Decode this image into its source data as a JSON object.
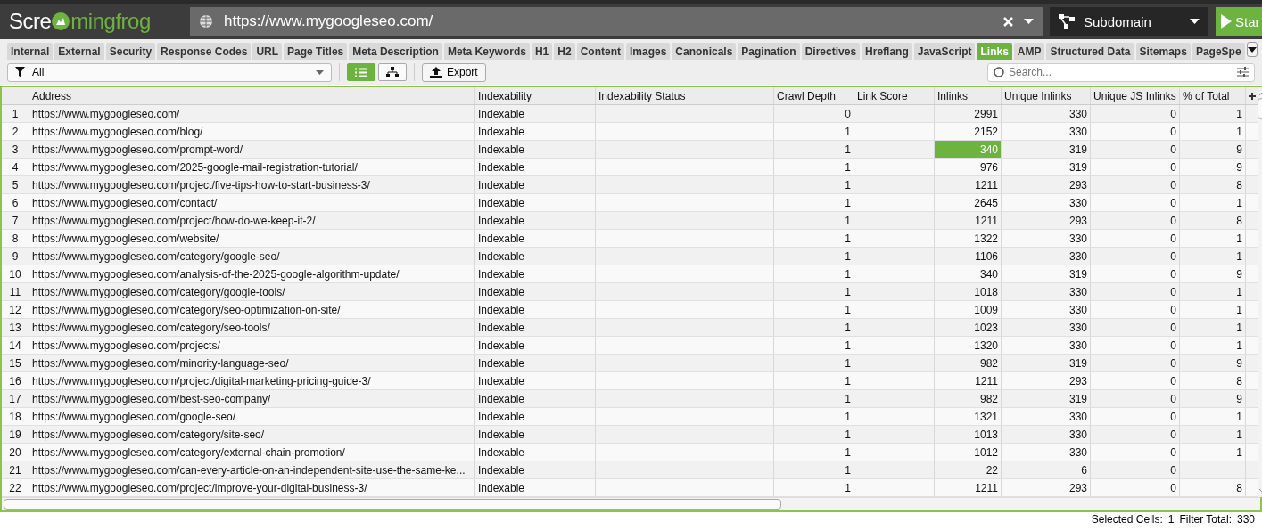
{
  "header": {
    "logo": {
      "before": "Scre",
      "after": "mingfrog"
    },
    "url_field": {
      "value": "https://www.mygoogleseo.com/"
    },
    "mode_dropdown": {
      "label": "Subdomain"
    },
    "start_button": {
      "label": "Star"
    }
  },
  "tabs": [
    {
      "label": "Internal",
      "selected": false
    },
    {
      "label": "External",
      "selected": false
    },
    {
      "label": "Security",
      "selected": false
    },
    {
      "label": "Response Codes",
      "selected": false
    },
    {
      "label": "URL",
      "selected": false
    },
    {
      "label": "Page Titles",
      "selected": false
    },
    {
      "label": "Meta Description",
      "selected": false
    },
    {
      "label": "Meta Keywords",
      "selected": false
    },
    {
      "label": "H1",
      "selected": false
    },
    {
      "label": "H2",
      "selected": false
    },
    {
      "label": "Content",
      "selected": false
    },
    {
      "label": "Images",
      "selected": false
    },
    {
      "label": "Canonicals",
      "selected": false
    },
    {
      "label": "Pagination",
      "selected": false
    },
    {
      "label": "Directives",
      "selected": false
    },
    {
      "label": "Hreflang",
      "selected": false
    },
    {
      "label": "JavaScript",
      "selected": false
    },
    {
      "label": "Links",
      "selected": true
    },
    {
      "label": "AMP",
      "selected": false
    },
    {
      "label": "Structured Data",
      "selected": false
    },
    {
      "label": "Sitemaps",
      "selected": false
    },
    {
      "label": "PageSpe",
      "selected": false
    }
  ],
  "toolbar": {
    "filter": {
      "value": "All"
    },
    "views": [
      {
        "kind": "list",
        "selected": true
      },
      {
        "kind": "tree",
        "selected": false
      }
    ],
    "export_button": {
      "label": "Export"
    },
    "search": {
      "placeholder": "Search..."
    }
  },
  "table": {
    "columns": [
      "Address",
      "Indexability",
      "Indexability Status",
      "Crawl Depth",
      "Link Score",
      "Inlinks",
      "Unique Inlinks",
      "Unique JS Inlinks",
      "% of Total"
    ],
    "rows": [
      {
        "num": "1",
        "address": "https://www.mygoogleseo.com/",
        "indexability": "Indexable",
        "crawl_depth": "0",
        "inlinks": "2991",
        "unique_inlinks": "330",
        "unique_js_inlinks": "0",
        "pct_of_total": "1",
        "inlinks_selected": false
      },
      {
        "num": "2",
        "address": "https://www.mygoogleseo.com/blog/",
        "indexability": "Indexable",
        "crawl_depth": "1",
        "inlinks": "2152",
        "unique_inlinks": "330",
        "unique_js_inlinks": "0",
        "pct_of_total": "1",
        "inlinks_selected": false
      },
      {
        "num": "3",
        "address": "https://www.mygoogleseo.com/prompt-word/",
        "indexability": "Indexable",
        "crawl_depth": "1",
        "inlinks": "340",
        "unique_inlinks": "319",
        "unique_js_inlinks": "0",
        "pct_of_total": "9",
        "inlinks_selected": true
      },
      {
        "num": "4",
        "address": "https://www.mygoogleseo.com/2025-google-mail-registration-tutorial/",
        "indexability": "Indexable",
        "crawl_depth": "1",
        "inlinks": "976",
        "unique_inlinks": "319",
        "unique_js_inlinks": "0",
        "pct_of_total": "9",
        "inlinks_selected": false
      },
      {
        "num": "5",
        "address": "https://www.mygoogleseo.com/project/five-tips-how-to-start-business-3/",
        "indexability": "Indexable",
        "crawl_depth": "1",
        "inlinks": "1211",
        "unique_inlinks": "293",
        "unique_js_inlinks": "0",
        "pct_of_total": "8",
        "inlinks_selected": false
      },
      {
        "num": "6",
        "address": "https://www.mygoogleseo.com/contact/",
        "indexability": "Indexable",
        "crawl_depth": "1",
        "inlinks": "2645",
        "unique_inlinks": "330",
        "unique_js_inlinks": "0",
        "pct_of_total": "1",
        "inlinks_selected": false
      },
      {
        "num": "7",
        "address": "https://www.mygoogleseo.com/project/how-do-we-keep-it-2/",
        "indexability": "Indexable",
        "crawl_depth": "1",
        "inlinks": "1211",
        "unique_inlinks": "293",
        "unique_js_inlinks": "0",
        "pct_of_total": "8",
        "inlinks_selected": false
      },
      {
        "num": "8",
        "address": "https://www.mygoogleseo.com/website/",
        "indexability": "Indexable",
        "crawl_depth": "1",
        "inlinks": "1322",
        "unique_inlinks": "330",
        "unique_js_inlinks": "0",
        "pct_of_total": "1",
        "inlinks_selected": false
      },
      {
        "num": "9",
        "address": "https://www.mygoogleseo.com/category/google-seo/",
        "indexability": "Indexable",
        "crawl_depth": "1",
        "inlinks": "1106",
        "unique_inlinks": "330",
        "unique_js_inlinks": "0",
        "pct_of_total": "1",
        "inlinks_selected": false
      },
      {
        "num": "10",
        "address": "https://www.mygoogleseo.com/analysis-of-the-2025-google-algorithm-update/",
        "indexability": "Indexable",
        "crawl_depth": "1",
        "inlinks": "340",
        "unique_inlinks": "319",
        "unique_js_inlinks": "0",
        "pct_of_total": "9",
        "inlinks_selected": false
      },
      {
        "num": "11",
        "address": "https://www.mygoogleseo.com/category/google-tools/",
        "indexability": "Indexable",
        "crawl_depth": "1",
        "inlinks": "1018",
        "unique_inlinks": "330",
        "unique_js_inlinks": "0",
        "pct_of_total": "1",
        "inlinks_selected": false
      },
      {
        "num": "12",
        "address": "https://www.mygoogleseo.com/category/seo-optimization-on-site/",
        "indexability": "Indexable",
        "crawl_depth": "1",
        "inlinks": "1009",
        "unique_inlinks": "330",
        "unique_js_inlinks": "0",
        "pct_of_total": "1",
        "inlinks_selected": false
      },
      {
        "num": "13",
        "address": "https://www.mygoogleseo.com/category/seo-tools/",
        "indexability": "Indexable",
        "crawl_depth": "1",
        "inlinks": "1023",
        "unique_inlinks": "330",
        "unique_js_inlinks": "0",
        "pct_of_total": "1",
        "inlinks_selected": false
      },
      {
        "num": "14",
        "address": "https://www.mygoogleseo.com/projects/",
        "indexability": "Indexable",
        "crawl_depth": "1",
        "inlinks": "1320",
        "unique_inlinks": "330",
        "unique_js_inlinks": "0",
        "pct_of_total": "1",
        "inlinks_selected": false
      },
      {
        "num": "15",
        "address": "https://www.mygoogleseo.com/minority-language-seo/",
        "indexability": "Indexable",
        "crawl_depth": "1",
        "inlinks": "982",
        "unique_inlinks": "319",
        "unique_js_inlinks": "0",
        "pct_of_total": "9",
        "inlinks_selected": false
      },
      {
        "num": "16",
        "address": "https://www.mygoogleseo.com/project/digital-marketing-pricing-guide-3/",
        "indexability": "Indexable",
        "crawl_depth": "1",
        "inlinks": "1211",
        "unique_inlinks": "293",
        "unique_js_inlinks": "0",
        "pct_of_total": "8",
        "inlinks_selected": false
      },
      {
        "num": "17",
        "address": "https://www.mygoogleseo.com/best-seo-company/",
        "indexability": "Indexable",
        "crawl_depth": "1",
        "inlinks": "982",
        "unique_inlinks": "319",
        "unique_js_inlinks": "0",
        "pct_of_total": "9",
        "inlinks_selected": false
      },
      {
        "num": "18",
        "address": "https://www.mygoogleseo.com/google-seo/",
        "indexability": "Indexable",
        "crawl_depth": "1",
        "inlinks": "1321",
        "unique_inlinks": "330",
        "unique_js_inlinks": "0",
        "pct_of_total": "1",
        "inlinks_selected": false
      },
      {
        "num": "19",
        "address": "https://www.mygoogleseo.com/category/site-seo/",
        "indexability": "Indexable",
        "crawl_depth": "1",
        "inlinks": "1013",
        "unique_inlinks": "330",
        "unique_js_inlinks": "0",
        "pct_of_total": "1",
        "inlinks_selected": false
      },
      {
        "num": "20",
        "address": "https://www.mygoogleseo.com/category/external-chain-promotion/",
        "indexability": "Indexable",
        "crawl_depth": "1",
        "inlinks": "1012",
        "unique_inlinks": "330",
        "unique_js_inlinks": "0",
        "pct_of_total": "1",
        "inlinks_selected": false
      },
      {
        "num": "21",
        "address": "https://www.mygoogleseo.com/can-every-article-on-an-independent-site-use-the-same-ke...",
        "indexability": "Indexable",
        "crawl_depth": "1",
        "inlinks": "22",
        "unique_inlinks": "6",
        "unique_js_inlinks": "0",
        "inlinks_selected": false
      },
      {
        "num": "22",
        "address": "https://www.mygoogleseo.com/project/improve-your-digital-business-3/",
        "indexability": "Indexable",
        "crawl_depth": "1",
        "inlinks": "1211",
        "unique_inlinks": "293",
        "unique_js_inlinks": "0",
        "pct_of_total": "8",
        "inlinks_selected": false
      }
    ]
  },
  "status_bar": {
    "selected_label": "Selected Cells:",
    "selected_value": "1",
    "total_label": "Filter Total:",
    "total_value": "330"
  }
}
